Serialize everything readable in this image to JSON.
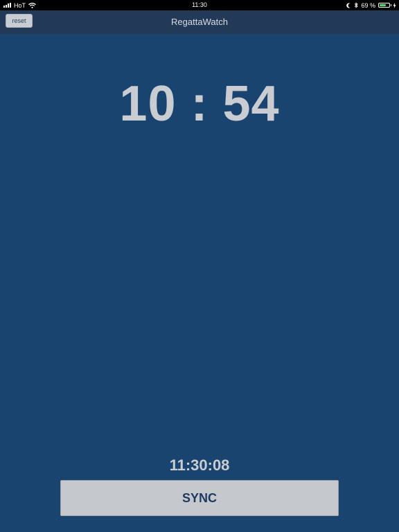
{
  "status_bar": {
    "carrier": "HoT",
    "time": "11:30",
    "battery_percent_label": "69 %",
    "battery_level": 0.69,
    "icons": [
      "signal-icon",
      "wifi-icon",
      "moon-icon",
      "bluetooth-icon",
      "battery-icon",
      "charging-icon"
    ]
  },
  "nav": {
    "title": "RegattaWatch",
    "reset_label": "reset"
  },
  "timer": {
    "display": "10 : 54"
  },
  "clock": {
    "time": "11:30:08"
  },
  "actions": {
    "sync_label": "SYNC"
  },
  "colors": {
    "background": "#1a4470",
    "nav_bar": "#223a58",
    "text": "#c9ccd1",
    "button": "#c5c9ce",
    "button_text": "#1e3a5f",
    "battery_fill": "#4cd964"
  }
}
